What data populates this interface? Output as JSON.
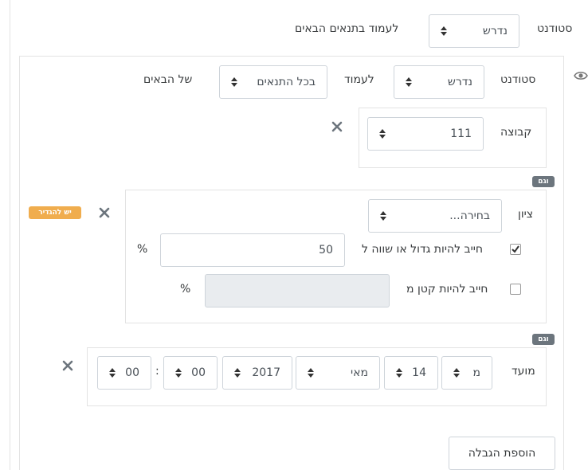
{
  "top_row": {
    "student_label": "סטודנט",
    "student_value": "נדרש",
    "condition_text": "לעמוד בתנאים הבאים"
  },
  "inner_row": {
    "student_label": "סטודנט",
    "student_value": "נדרש",
    "must_label": "לעמוד",
    "all_value": "בכל התנאים",
    "of_following": "של הבאים"
  },
  "group": {
    "label": "קבוצה",
    "value": "111"
  },
  "and_tag": "וגם",
  "grade": {
    "label": "ציון",
    "select_value": "בחירה...",
    "ge_label": "חייב להיות גדול או שווה ל",
    "ge_value": "50",
    "ge_checked": true,
    "lt_label": "חייב להיות קטן מ",
    "lt_value": "",
    "lt_checked": false,
    "percent": "%",
    "badge": "יש להגדיר"
  },
  "date": {
    "label": "מועד",
    "direction": "מ",
    "day": "14",
    "month": "מאי",
    "year": "2017",
    "hour": "00",
    "minute": "00",
    "colon": ":"
  },
  "add_restriction_button": "הוספת הגבלה",
  "icons": [
    "eye-icon",
    "close-icon",
    "sort-arrows-icon",
    "checkbox-icon"
  ],
  "colors": {
    "tag": "#6c757d",
    "badge": "#f0ad4e",
    "border": "#ced4da"
  }
}
